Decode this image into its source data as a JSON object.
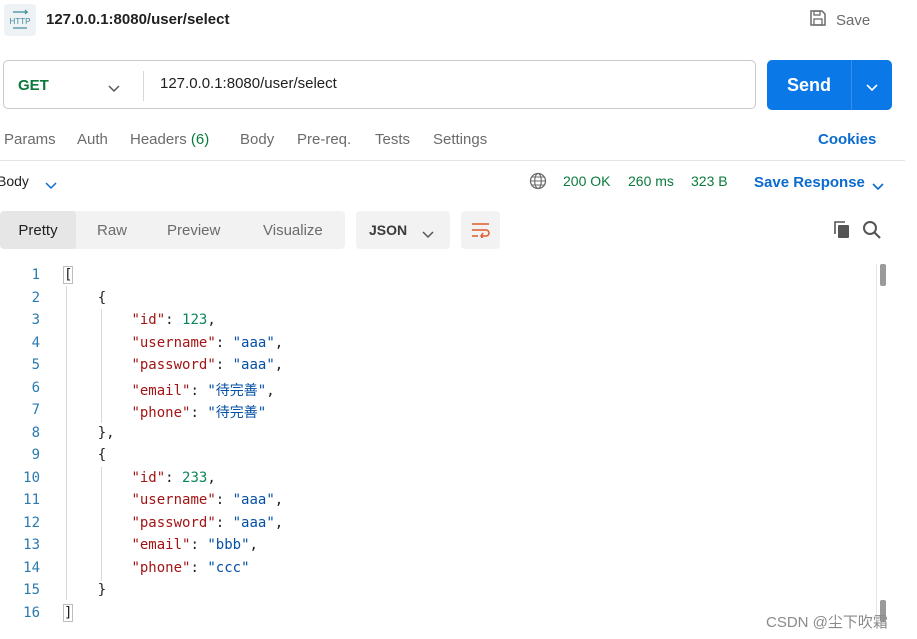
{
  "title_bar": {
    "http_icon_label": "HTTP",
    "title": "127.0.0.1:8080/user/select",
    "save_label": "Save"
  },
  "request": {
    "method": "GET",
    "url": "127.0.0.1:8080/user/select",
    "send_label": "Send"
  },
  "request_tabs": {
    "params": "Params",
    "auth": "Auth",
    "headers": "Headers",
    "headers_count": "(6)",
    "body": "Body",
    "prereq": "Pre-req.",
    "tests": "Tests",
    "settings": "Settings",
    "cookies": "Cookies"
  },
  "response": {
    "body_tab": "Body",
    "status": "200 OK",
    "time": "260 ms",
    "size": "323 B",
    "save_response": "Save Response"
  },
  "view_tabs": {
    "pretty": "Pretty",
    "raw": "Raw",
    "preview": "Preview",
    "visualize": "Visualize",
    "format": "JSON"
  },
  "code": {
    "line_numbers": [
      "1",
      "2",
      "3",
      "4",
      "5",
      "6",
      "7",
      "8",
      "9",
      "10",
      "11",
      "12",
      "13",
      "14",
      "15",
      "16"
    ],
    "records": [
      {
        "id": "123",
        "username": "aaa",
        "password": "aaa",
        "email": "待完善",
        "phone": "待完善"
      },
      {
        "id": "233",
        "username": "aaa",
        "password": "aaa",
        "email": "bbb",
        "phone": "ccc"
      }
    ],
    "keys": {
      "id": "id",
      "username": "username",
      "password": "password",
      "email": "email",
      "phone": "phone"
    }
  },
  "watermark": "CSDN @尘下吹霜",
  "icons": [
    "http-icon",
    "save-icon",
    "chevron-down-icon",
    "globe-icon",
    "wrap-lines-icon",
    "copy-icon",
    "search-icon"
  ]
}
